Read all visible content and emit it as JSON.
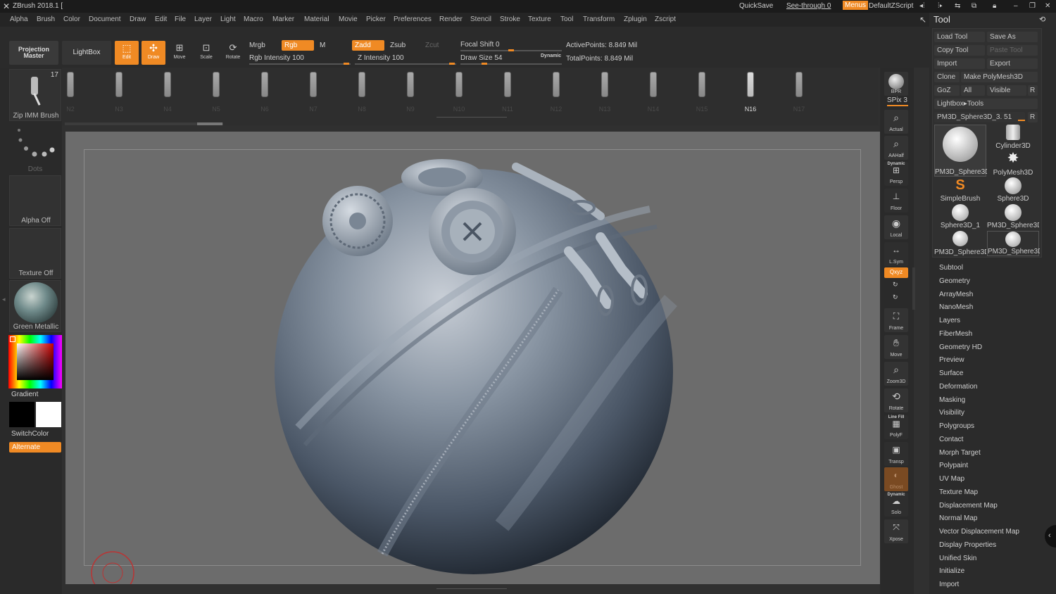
{
  "titlebar": {
    "app": "ZBrush 2018.1 [",
    "quicksave": "QuickSave",
    "seethrough": "See-through 0",
    "menus": "Menus",
    "script": "DefaultZScript"
  },
  "menu": [
    "Alpha",
    "Brush",
    "Color",
    "Document",
    "Draw",
    "Edit",
    "File",
    "Layer",
    "Light",
    "Macro",
    "Marker",
    "Material",
    "Movie",
    "Picker",
    "Preferences",
    "Render",
    "Stencil",
    "Stroke",
    "Texture",
    "Tool",
    "Transform",
    "Zplugin",
    "Zscript"
  ],
  "toolbar": {
    "projection_master": "Projection Master",
    "lightbox": "LightBox",
    "edit": "Edit",
    "draw": "Draw",
    "move": "Move",
    "scale": "Scale",
    "rotate": "Rotate",
    "mrgb": "Mrgb",
    "rgb": "Rgb",
    "m": "M",
    "rgb_intensity": "Rgb Intensity 100",
    "zadd": "Zadd",
    "zsub": "Zsub",
    "zcut": "Zcut",
    "z_intensity": "Z Intensity 100",
    "focal_shift": "Focal Shift 0",
    "draw_size": "Draw Size 54",
    "dynamic": "Dynamic",
    "active_points": "ActivePoints: 8.849 Mil",
    "total_points": "TotalPoints: 8.849 Mil"
  },
  "brushes": [
    "N2",
    "N3",
    "N4",
    "N5",
    "N6",
    "N7",
    "N8",
    "N9",
    "N10",
    "N11",
    "N12",
    "N13",
    "N14",
    "N15",
    "N16",
    "N17"
  ],
  "active_brush": "N16",
  "left": {
    "brush_count": "17",
    "brush_name": "Zip IMM Brush",
    "stroke": "Dots",
    "alpha": "Alpha Off",
    "texture": "Texture Off",
    "material": "Green Metallic",
    "gradient": "Gradient",
    "switchcolor": "SwitchColor",
    "alternate": "Alternate"
  },
  "right": {
    "bpr": "BPR",
    "spix": "SPix 3",
    "actual": "Actual",
    "aahalf": "AAHalf",
    "dynamic": "Dynamic",
    "persp": "Persp",
    "floor": "Floor",
    "local": "Local",
    "lsym": "L.Sym",
    "xyz": "Qxyz",
    "frame": "Frame",
    "move": "Move",
    "zoom": "Zoom3D",
    "rotate": "Rotate",
    "linefill": "Line Fill",
    "polyf": "PolyF",
    "transp": "Transp",
    "ghost": "Ghost",
    "dyn2": "Dynamic",
    "solo": "Solo",
    "xpose": "Xpose"
  },
  "tool": {
    "title": "Tool",
    "buttons": {
      "load": "Load Tool",
      "saveas": "Save As",
      "copy": "Copy Tool",
      "paste": "Paste Tool",
      "import": "Import",
      "export": "Export",
      "clone": "Clone",
      "makepoly": "Make PolyMesh3D",
      "goz": "GoZ",
      "all": "All",
      "visible": "Visible",
      "r": "R",
      "lightbox_tools": "Lightbox▸Tools",
      "current": "PM3D_Sphere3D_3. 51"
    },
    "thumbs": [
      "PM3D_Sphere3D",
      "Cylinder3D",
      "PolyMesh3D",
      "SimpleBrush",
      "Sphere3D",
      "Sphere3D_1",
      "PM3D_Sphere3D",
      "PM3D_Sphere3D",
      "PM3D_Sphere3D"
    ],
    "sections": [
      "Subtool",
      "Geometry",
      "ArrayMesh",
      "NanoMesh",
      "Layers",
      "FiberMesh",
      "Geometry HD",
      "Preview",
      "Surface",
      "Deformation",
      "Masking",
      "Visibility",
      "Polygroups",
      "Contact",
      "Morph Target",
      "Polypaint",
      "UV Map",
      "Texture Map",
      "Displacement Map",
      "Normal Map",
      "Vector Displacement Map",
      "Display Properties",
      "Unified Skin",
      "Initialize",
      "Import"
    ]
  },
  "colors": {
    "accent": "#f08a24",
    "canvas": "#6c6c6c"
  }
}
